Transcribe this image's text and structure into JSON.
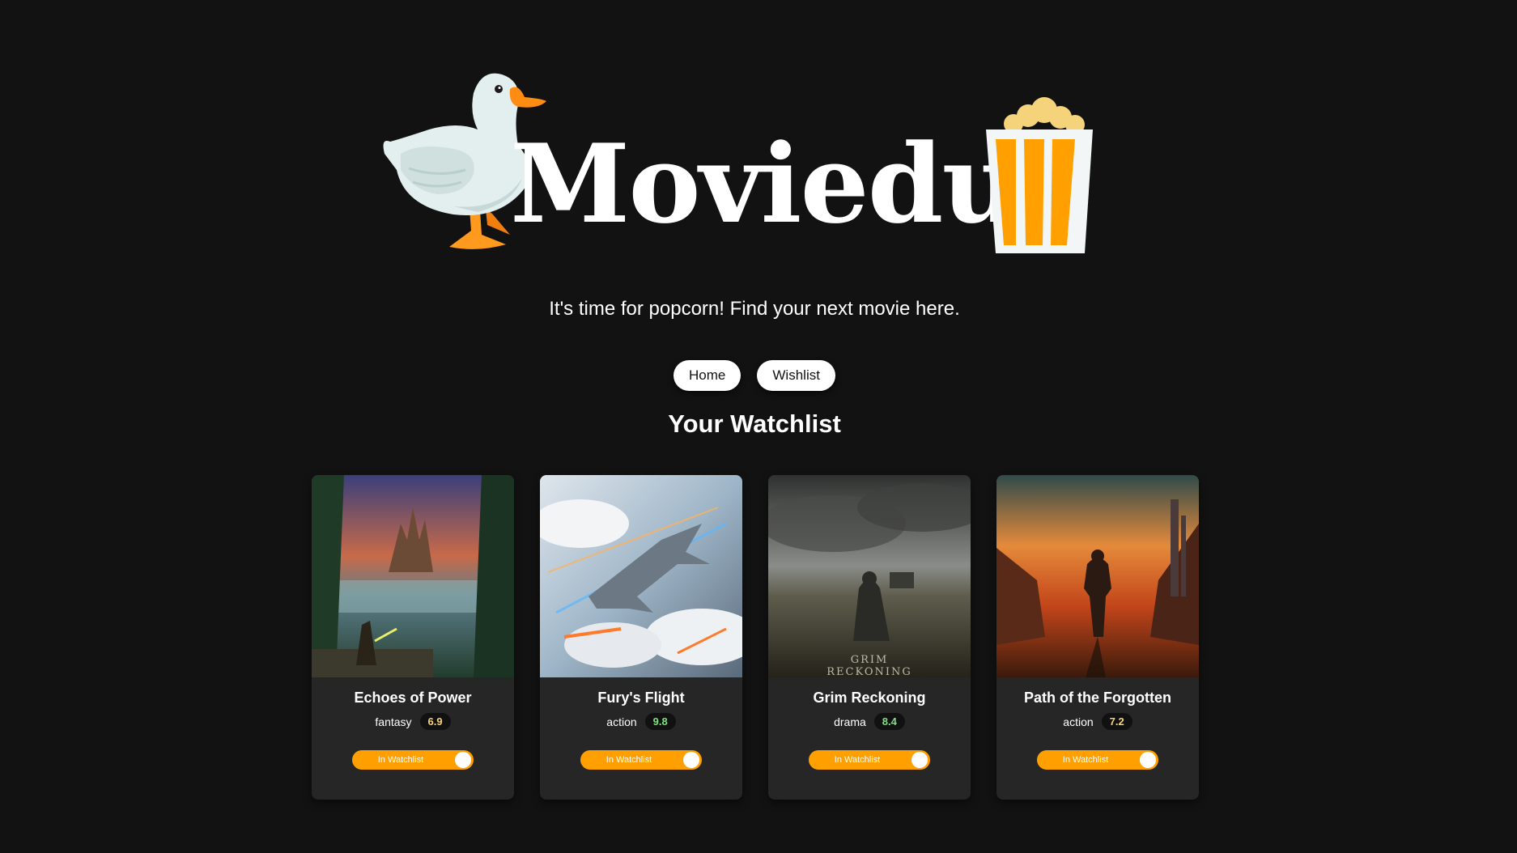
{
  "app": {
    "name": "Moviedux",
    "tagline": "It's time for popcorn! Find your next movie here."
  },
  "nav": {
    "home_label": "Home",
    "wishlist_label": "Wishlist"
  },
  "section": {
    "title": "Your Watchlist"
  },
  "movies": [
    {
      "title": "Echoes of Power",
      "genre": "fantasy",
      "rating": "6.9",
      "rating_color": "#f5d37a",
      "toggle_label": "In Watchlist"
    },
    {
      "title": "Fury's Flight",
      "genre": "action",
      "rating": "9.8",
      "rating_color": "#7fe07f",
      "toggle_label": "In Watchlist"
    },
    {
      "title": "Grim Reckoning",
      "genre": "drama",
      "rating": "8.4",
      "rating_color": "#7fe07f",
      "toggle_label": "In Watchlist"
    },
    {
      "title": "Path of the Forgotten",
      "genre": "action",
      "rating": "7.2",
      "rating_color": "#f5d37a",
      "toggle_label": "In Watchlist"
    }
  ],
  "poster_texts": {
    "grim_reckoning": [
      "GRIM",
      "RECKONING"
    ]
  },
  "colors": {
    "background": "#121212",
    "card": "#262626",
    "accent": "#ffa000"
  }
}
